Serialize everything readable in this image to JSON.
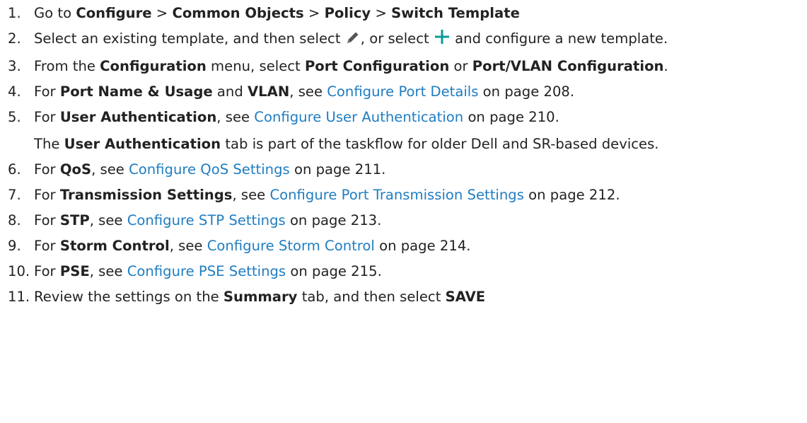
{
  "steps": [
    {
      "number": "1.",
      "prefix": "Go to ",
      "path": [
        "Configure",
        "Common Objects",
        "Policy",
        "Switch Template"
      ],
      "separator": " > "
    },
    {
      "number": "2.",
      "text_a": "Select an existing template, and then select ",
      "icon_a": "pencil-edit-icon",
      "text_b": ", or select ",
      "icon_b": "plus-add-icon",
      "text_c": " and configure a new template."
    },
    {
      "number": "3.",
      "text_a": "From the ",
      "bold_a": "Configuration",
      "text_b": " menu, select ",
      "bold_b": "Port Configuration",
      "text_c": " or ",
      "bold_c": "Port/VLAN Configuration",
      "text_d": "."
    },
    {
      "number": "4.",
      "text_a": "For ",
      "bold_a": "Port Name & Usage",
      "text_b": " and ",
      "bold_b": "VLAN",
      "text_c": ", see ",
      "link": "Configure Port Details",
      "page": " on page 208."
    },
    {
      "number": "5.",
      "text_a": "For ",
      "bold_a": "User Authentication",
      "text_b": ", see ",
      "link": "Configure User Authentication",
      "page": " on page 210.",
      "note_prefix": "The ",
      "note_bold": "User Authentication",
      "note_rest": " tab is part of the taskflow for older Dell and SR-based devices."
    },
    {
      "number": "6.",
      "text_a": "For ",
      "bold_a": "QoS",
      "text_b": ", see ",
      "link": "Configure QoS Settings",
      "page": " on page 211."
    },
    {
      "number": "7.",
      "text_a": "For ",
      "bold_a": "Transmission Settings",
      "text_b": ", see ",
      "link": "Configure Port Transmission Settings",
      "page": " on page 212."
    },
    {
      "number": "8.",
      "text_a": "For ",
      "bold_a": "STP",
      "text_b": ", see ",
      "link": "Configure STP Settings",
      "page": " on page 213."
    },
    {
      "number": "9.",
      "text_a": "For ",
      "bold_a": "Storm Control",
      "text_b": ", see ",
      "link": "Configure Storm Control",
      "page": " on page 214."
    },
    {
      "number": "10.",
      "text_a": "For ",
      "bold_a": "PSE",
      "text_b": ", see ",
      "link": "Configure PSE Settings",
      "page": " on page 215."
    },
    {
      "number": "11.",
      "text_a": "Review the settings on the ",
      "bold_a": "Summary",
      "text_b": " tab, and then select ",
      "bold_b": "SAVE"
    }
  ],
  "colors": {
    "link": "#1f7dc1",
    "plus_icon": "#0a9a94",
    "pencil_icon": "#555555",
    "text": "#222222"
  }
}
